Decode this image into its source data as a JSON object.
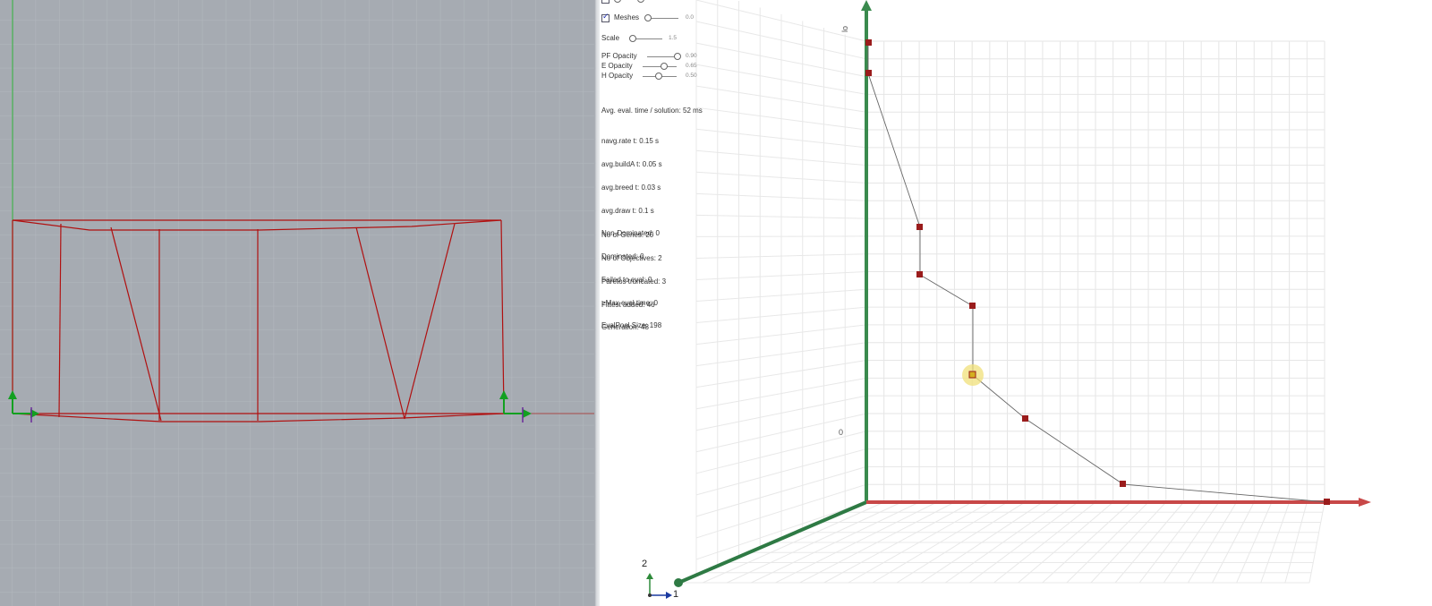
{
  "panel": {
    "meshes_checked": true,
    "meshes_label": "Meshes",
    "meshes_value": "0.0",
    "scale_label": "Scale",
    "scale_value": "1.5",
    "pf_opacity_label": "PF Opacity",
    "pf_opacity_value": "0.90",
    "e_opacity_label": "E Opacity",
    "e_opacity_value": "0.65",
    "h_opacity_label": "H Opacity",
    "h_opacity_value": "0.50",
    "avg_eval": "Avg. eval. time / solution: 52 ms",
    "timing": [
      "navg.rate t: 0.15 s",
      "avg.buildA t: 0.05 s",
      "avg.breed t: 0.03 s",
      "avg.draw t: 0.1 s",
      "Non-Dominated: 0",
      "Dominated: 0",
      "Failed to eval: 0",
      ">Max eval time: 0",
      "EvalPool Size: 198"
    ],
    "genes": [
      "No of Genes: 20",
      "No of Objectives: 2",
      "Paretos truncated: 3",
      "Fittest added: 46",
      "Generation: 48"
    ]
  },
  "gnomon": {
    "axis_a": "2",
    "axis_b": "1"
  },
  "axis_glyphs": {
    "vertical": "lo",
    "lower": "0"
  },
  "colors": {
    "left_viewport_bg": "#a6abb2",
    "truss": "#b01010",
    "pareto_marker": "#9a1c1c",
    "selected_marker": "#d4b020",
    "x_axis": "#c84848",
    "y_axis": "#3a8a4e",
    "z_axis": "#2e7a44"
  }
}
